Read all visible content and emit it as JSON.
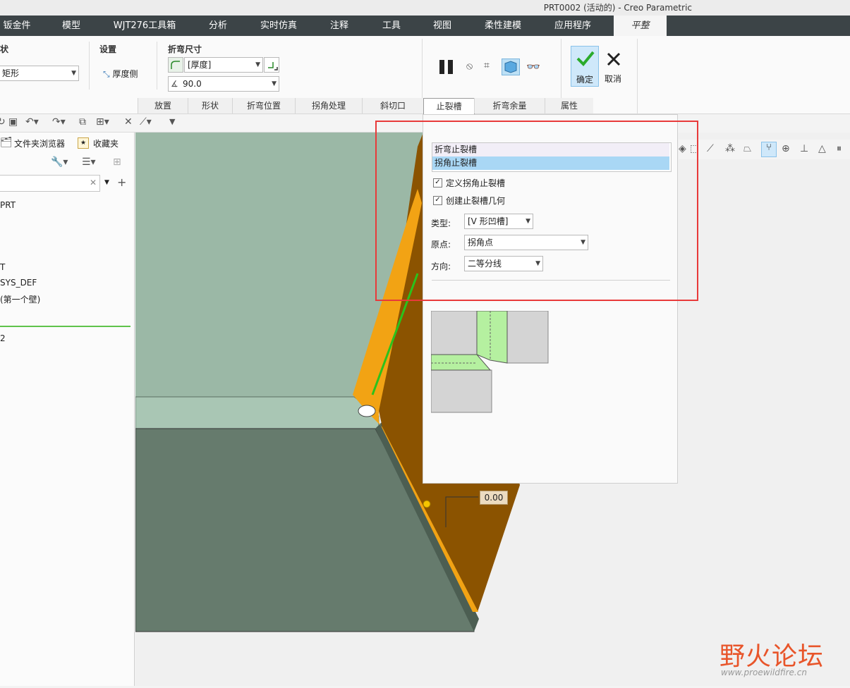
{
  "window": {
    "title": "PRT0002 (活动的) - Creo Parametric"
  },
  "menu_tabs": [
    "钣金件",
    "模型",
    "WJT276工具箱",
    "分析",
    "实时仿真",
    "注释",
    "工具",
    "视图",
    "柔性建模",
    "应用程序",
    "平整"
  ],
  "ribbon": {
    "shape_group_label": "状",
    "shape_value": "矩形",
    "settings_label": "设置",
    "thickness_side_label": "厚度侧",
    "bend_dim_label": "折弯尺寸",
    "bend_radius_value": "[厚度]",
    "bend_angle_value": "90.0",
    "confirm_label": "确定",
    "cancel_label": "取消"
  },
  "subtabs": [
    "放置",
    "形状",
    "折弯位置",
    "拐角处理",
    "斜切口",
    "止裂槽",
    "折弯余量",
    "属性"
  ],
  "left_panel": {
    "tab_folder": "文件夹浏览器",
    "tab_favorites": "收藏夹",
    "tree_items": [
      "PRT",
      "",
      "",
      "T",
      "SYS_DEF",
      "(第一个壁)",
      "2"
    ]
  },
  "relief_panel": {
    "list_items": [
      "折弯止裂槽",
      "拐角止裂槽"
    ],
    "define_corner_relief": "定义拐角止裂槽",
    "create_relief_geometry": "创建止裂槽几何",
    "type_label": "类型:",
    "type_value": "[V 形凹槽]",
    "origin_label": "原点:",
    "origin_value": "拐角点",
    "direction_label": "方向:",
    "direction_value": "二等分线"
  },
  "viewport": {
    "dimension_value": "0.00"
  },
  "watermark": {
    "title": "野火论坛",
    "url": "www.proewildfire.cn"
  },
  "colors": {
    "accent_red": "#e83a3a",
    "sheet_orange": "#f2a314",
    "selection_blue": "#a9d7f5",
    "bend_green": "#2bc21c"
  }
}
